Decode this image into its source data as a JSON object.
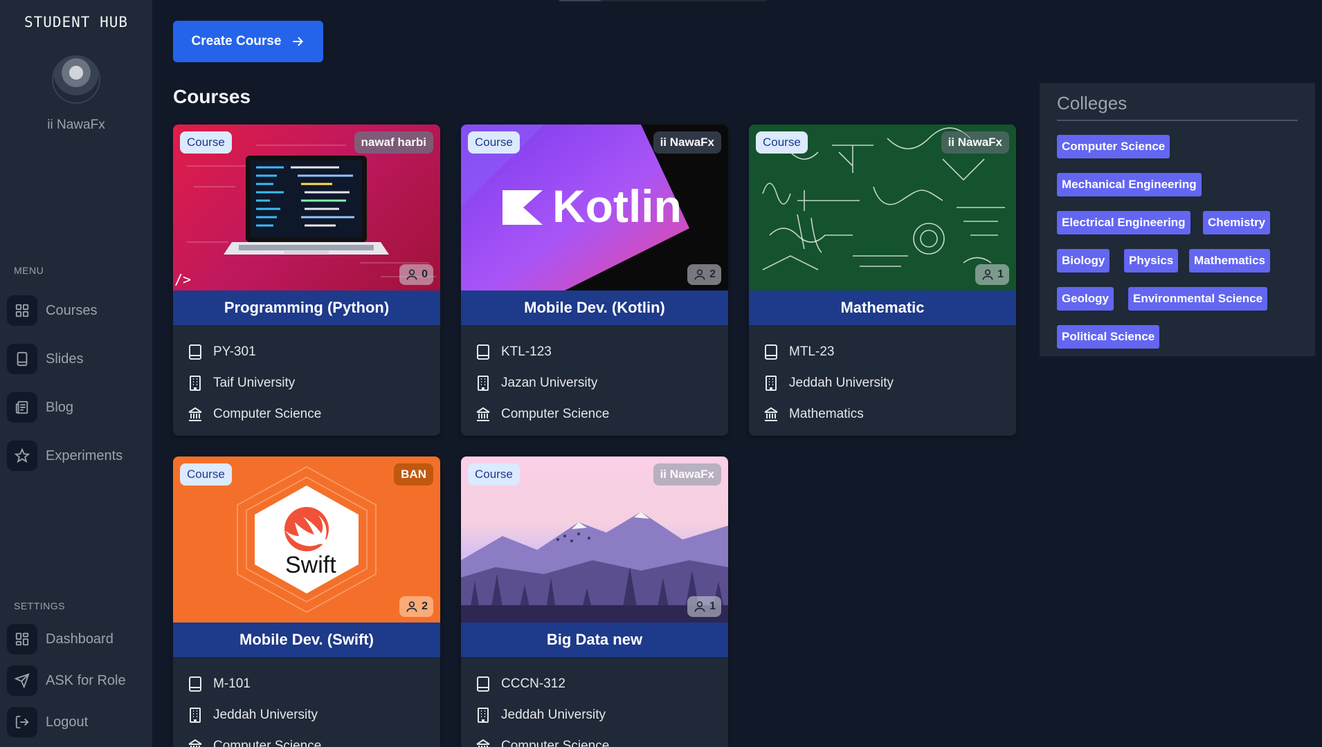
{
  "app": {
    "brand": "STUDENT HUB",
    "username": "ii NawaFx"
  },
  "sidebar": {
    "menu_label": "MENU",
    "settings_label": "SETTINGS",
    "menu_items": [
      {
        "label": "Courses",
        "icon": "grid-icon"
      },
      {
        "label": "Slides",
        "icon": "tablet-icon"
      },
      {
        "label": "Blog",
        "icon": "newspaper-icon"
      },
      {
        "label": "Experiments",
        "icon": "star-icon"
      }
    ],
    "settings_items": [
      {
        "label": "Dashboard",
        "icon": "grid-icon"
      },
      {
        "label": "ASK for Role",
        "icon": "send-icon"
      },
      {
        "label": "Logout",
        "icon": "logout-icon"
      }
    ]
  },
  "main": {
    "create_button": "Create Course",
    "title": "Courses",
    "course_chip": "Course",
    "courses": [
      {
        "title": "Programming (Python)",
        "author": "nawaf harbi",
        "count": "0",
        "code": "PY-301",
        "university": "Taif University",
        "college": "Computer Science"
      },
      {
        "title": "Mobile Dev. (Kotlin)",
        "author": "ii NawaFx",
        "count": "2",
        "code": "KTL-123",
        "university": "Jazan University",
        "college": "Computer Science"
      },
      {
        "title": "Mathematic",
        "author": "ii NawaFx",
        "count": "1",
        "code": "MTL-23",
        "university": "Jeddah University",
        "college": "Mathematics"
      },
      {
        "title": "Mobile Dev. (Swift)",
        "author": "BAN",
        "count": "2",
        "code": "M-101",
        "university": "Jeddah University",
        "college": "Computer Science"
      },
      {
        "title": "Big Data new",
        "author": "ii NawaFx",
        "count": "1",
        "code": "CCCN-312",
        "university": "Jeddah University",
        "college": "Computer Science"
      }
    ],
    "thumb_text": {
      "kotlin": "Kotlin",
      "swift": "Swift",
      "python_code": "/>"
    }
  },
  "colleges": {
    "title": "Colleges",
    "tags": [
      "Computer Science",
      "Mechanical Engineering",
      "Electrical Engineering",
      "Chemistry",
      "Biology",
      "Physics",
      "Mathematics",
      "Geology",
      "Environmental Science",
      "Political Science"
    ]
  }
}
